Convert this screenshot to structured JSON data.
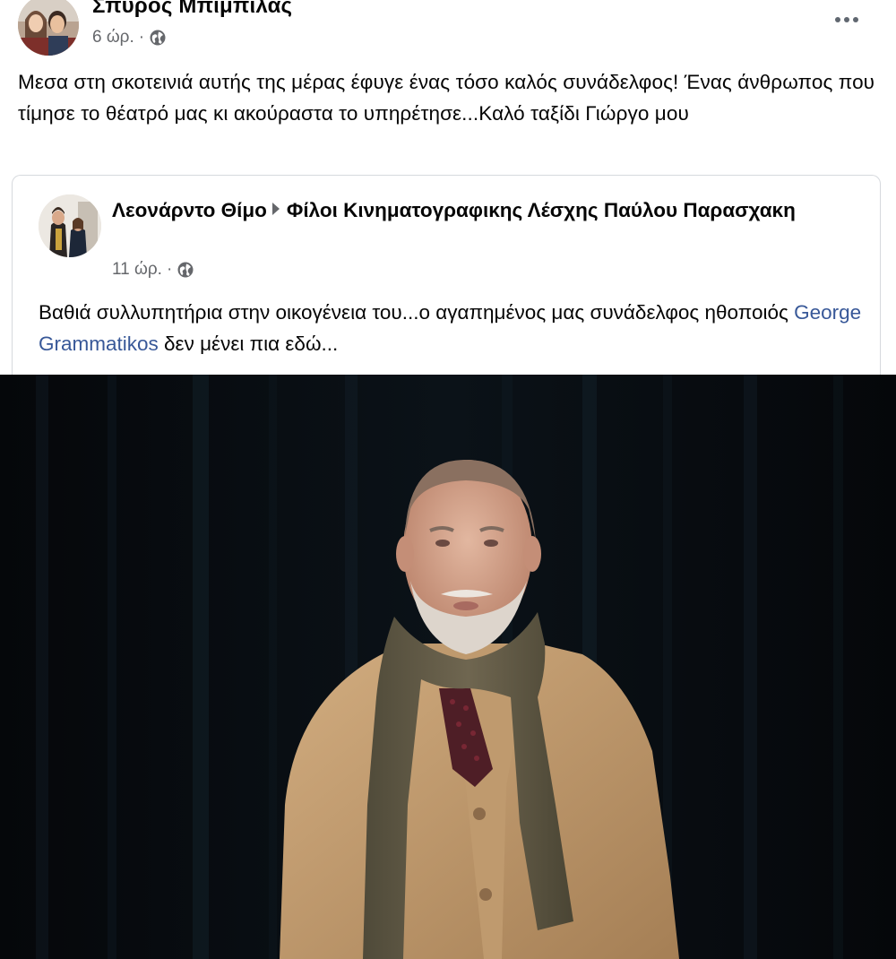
{
  "post": {
    "author": "Σπύρος Μπιμπίλας",
    "time": "6 ώρ.",
    "dot": "·",
    "privacy_icon": "globe-icon",
    "more_icon": "more-options-icon",
    "text": "Μεσα στη σκοτεινιά αυτής της μέρας έφυγε ένας τόσο καλός συνάδελφος! Ένας άνθρωπος που τίμησε το θέατρό μας  κι ακούραστα το υπηρέτησε...Καλό ταξίδι Γιώργο μου"
  },
  "shared": {
    "author": "Λεονάρντο Θίμο",
    "arrow_icon": "triangle-right-icon",
    "group": "Φίλοι Κινηματογραφικης Λέσχης Παύλου Παρασχακη",
    "time": "11 ώρ.",
    "dot": "·",
    "privacy_icon": "globe-icon",
    "text_before": "Βαθιά συλλυπητήρια στην οικογένεια του...ο αγαπημένος μας συνάδελφος ηθοποιός ",
    "mention": "George Grammatikos",
    "text_after": " δεν μένει πια εδώ..."
  },
  "colors": {
    "link": "#385898",
    "secondary_text": "#65676b",
    "border": "#d6d9dd"
  }
}
